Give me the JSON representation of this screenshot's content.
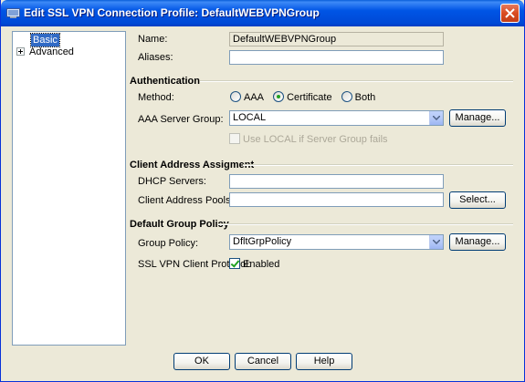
{
  "window": {
    "title": "Edit SSL VPN Connection Profile: DefaultWEBVPNGroup"
  },
  "tree": {
    "items": [
      {
        "label": "Basic",
        "selected": true
      },
      {
        "label": "Advanced",
        "expander": "+"
      }
    ]
  },
  "basic": {
    "name_label": "Name:",
    "name_value": "DefaultWEBVPNGroup",
    "aliases_label": "Aliases:",
    "aliases_value": ""
  },
  "authentication": {
    "section_title": "Authentication",
    "method_label": "Method:",
    "methods": [
      {
        "label": "AAA",
        "selected": false
      },
      {
        "label": "Certificate",
        "selected": true
      },
      {
        "label": "Both",
        "selected": false
      }
    ],
    "aaa_server_group_label": "AAA Server Group:",
    "aaa_server_group_value": "LOCAL",
    "manage_label": "Manage...",
    "use_local_label": "Use LOCAL if Server Group fails",
    "use_local_checked": false,
    "use_local_enabled": false
  },
  "client_address": {
    "section_title": "Client Address Assigment",
    "dhcp_label": "DHCP Servers:",
    "dhcp_value": "",
    "pools_label": "Client Address Pools:",
    "pools_value": "",
    "select_label": "Select..."
  },
  "group_policy": {
    "section_title": "Default Group Policy",
    "policy_label": "Group Policy:",
    "policy_value": "DfltGrpPolicy",
    "manage_label": "Manage...",
    "protocol_label": "SSL VPN Client Protocol:",
    "protocol_enabled_label": "Enabled",
    "protocol_enabled_checked": true
  },
  "footer": {
    "ok_label": "OK",
    "cancel_label": "Cancel",
    "help_label": "Help"
  },
  "colors": {
    "titlebar": "#0055e5",
    "dialog_bg": "#ece9d8",
    "selection": "#316ac5",
    "field_border": "#7f9db9"
  }
}
